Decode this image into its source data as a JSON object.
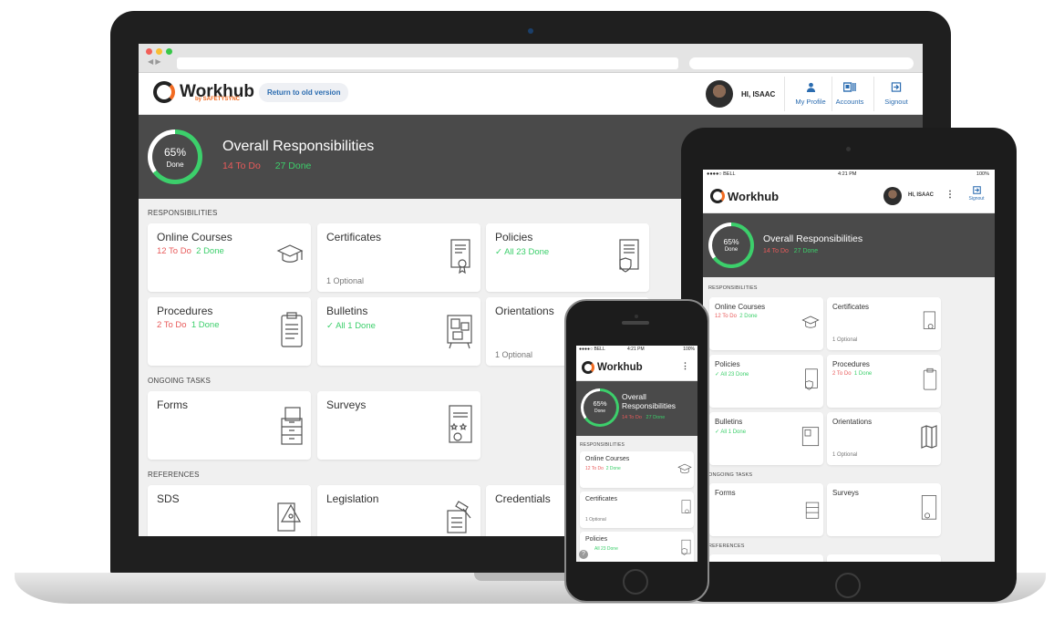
{
  "app": {
    "brand": "Workhub",
    "brand_sub": "by SAFETYSYNC",
    "old_version_label": "Return to old version",
    "greeting": "HI, ISAAC",
    "nav": [
      {
        "label": "My Profile",
        "icon": "person-icon"
      },
      {
        "label": "Accounts",
        "icon": "accounts-icon"
      },
      {
        "label": "Signout",
        "icon": "signout-icon"
      }
    ]
  },
  "summary": {
    "percent": "65%",
    "percent_value": 0.65,
    "done_word": "Done",
    "title": "Overall Responsibilities",
    "todo": "14 To Do",
    "done": "27 Done"
  },
  "sections": {
    "responsibilities": "RESPONSIBILITIES",
    "ongoing": "ONGOING TASKS",
    "references": "REFERENCES"
  },
  "cards": {
    "online_courses": {
      "title": "Online Courses",
      "todo": "12 To Do",
      "done": "2 Done",
      "icon": "graduation-cap-icon"
    },
    "certificates": {
      "title": "Certificates",
      "foot": "1 Optional",
      "icon": "certificate-icon"
    },
    "policies": {
      "title": "Policies",
      "done": "✓ All 23 Done",
      "icon": "policy-shield-icon"
    },
    "procedures": {
      "title": "Procedures",
      "todo": "2 To Do",
      "done": "1 Done",
      "icon": "clipboard-icon"
    },
    "bulletins": {
      "title": "Bulletins",
      "done": "✓ All 1 Done",
      "icon": "bulletin-board-icon"
    },
    "orientations": {
      "title": "Orientations",
      "foot": "1 Optional",
      "icon": "map-icon"
    },
    "forms": {
      "title": "Forms",
      "icon": "file-cabinet-icon"
    },
    "surveys": {
      "title": "Surveys",
      "icon": "survey-icon"
    },
    "sds": {
      "title": "SDS",
      "icon": "hazard-icon"
    },
    "legislation": {
      "title": "Legislation",
      "icon": "gavel-icon"
    },
    "credentials": {
      "title": "Credentials",
      "icon": "id-card-icon"
    }
  },
  "devices": {
    "tablet_status": {
      "carrier": "●●●●○ BELL",
      "time": "4:21 PM",
      "battery": "100%"
    },
    "phone_status": {
      "carrier": "●●●●○ BELL",
      "time": "4:21 PM",
      "battery": "100%"
    },
    "tablet_cards": {
      "policies_done": "✓ All 23 Done",
      "bulletins_done": "✓ All 1 Done"
    },
    "phone_cards": {
      "policies_done": "All 23 Done"
    },
    "phone_title_line1": "Overall",
    "phone_title_line2": "Responsibilities",
    "more_icon": "⋮",
    "help_badge": "?"
  },
  "colors": {
    "todo": "#e85a5a",
    "done": "#3ccf6b",
    "link": "#2b6cb0",
    "banner": "#4a4a4a"
  }
}
